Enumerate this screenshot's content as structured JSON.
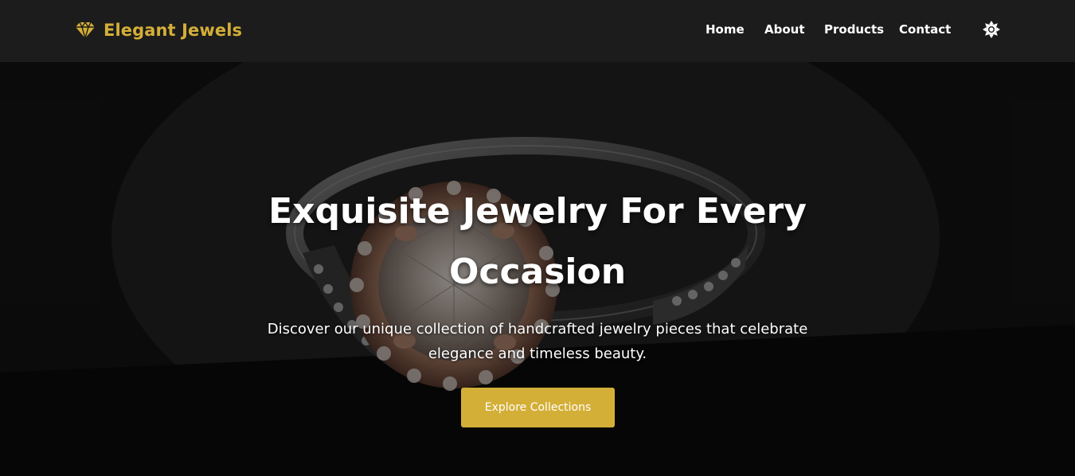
{
  "brand": {
    "name": "Elegant Jewels",
    "icon": "gem-icon",
    "color": "#d4af37"
  },
  "nav": {
    "items": [
      {
        "label": "Home"
      },
      {
        "label": "About"
      },
      {
        "label": "Products"
      },
      {
        "label": "Contact"
      }
    ],
    "theme_toggle_icon": "sun-gear-icon"
  },
  "hero": {
    "title": "Exquisite Jewelry For Every Occasion",
    "subtitle": "Discover our unique collection of handcrafted jewelry pieces that celebrate elegance and timeless beauty.",
    "cta_label": "Explore Collections",
    "background_image": "diamond-ring-photo",
    "accent_color": "#d4af37"
  }
}
